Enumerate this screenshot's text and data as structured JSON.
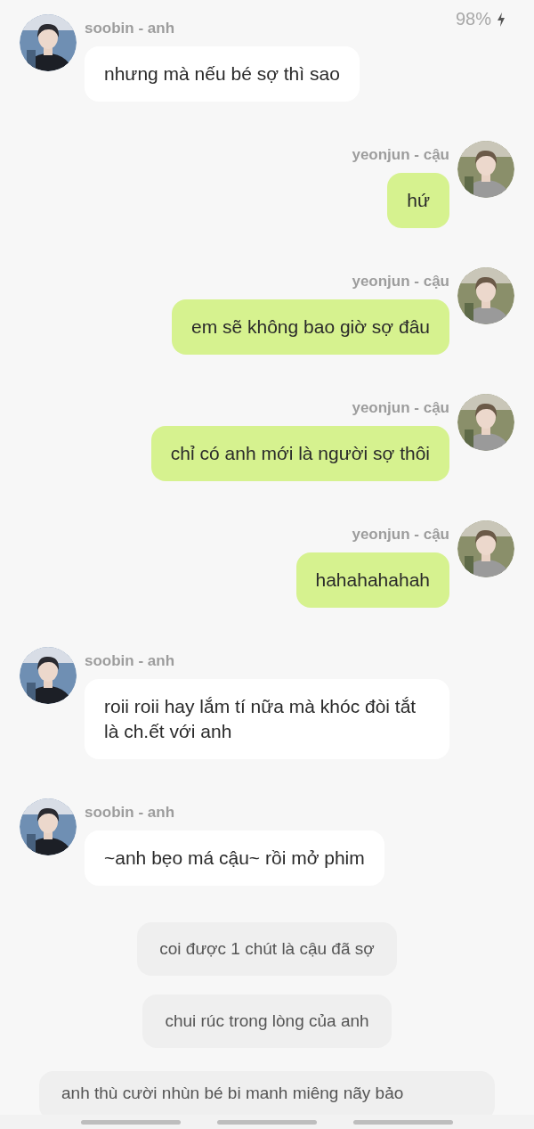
{
  "status_bar": {
    "battery": "98%"
  },
  "messages": [
    {
      "kind": "left",
      "sender": "soobin - anh",
      "text": "nhưng mà nếu bé sợ thì sao"
    },
    {
      "kind": "right",
      "sender": "yeonjun - cậu",
      "text": "hứ"
    },
    {
      "kind": "right",
      "sender": "yeonjun - cậu",
      "text": "em sẽ không bao giờ sợ đâu"
    },
    {
      "kind": "right",
      "sender": "yeonjun - cậu",
      "text": "chỉ có anh mới là người sợ thôi"
    },
    {
      "kind": "right",
      "sender": "yeonjun - cậu",
      "text": "hahahahahah"
    },
    {
      "kind": "left",
      "sender": "soobin - anh",
      "text": "roii roii hay lắm tí nữa mà khóc đòi tắt là ch.ết với anh"
    },
    {
      "kind": "left",
      "sender": "soobin - anh",
      "text": "~anh bẹo má cậu~ rồi mở phim"
    },
    {
      "kind": "narration",
      "text": "coi được 1 chút là cậu đã sợ"
    },
    {
      "kind": "narration",
      "text": "chui rúc trong lòng của anh"
    },
    {
      "kind": "narration",
      "text": "anh thù cười nhùn bé bi manh miêng nãy bảo"
    }
  ]
}
